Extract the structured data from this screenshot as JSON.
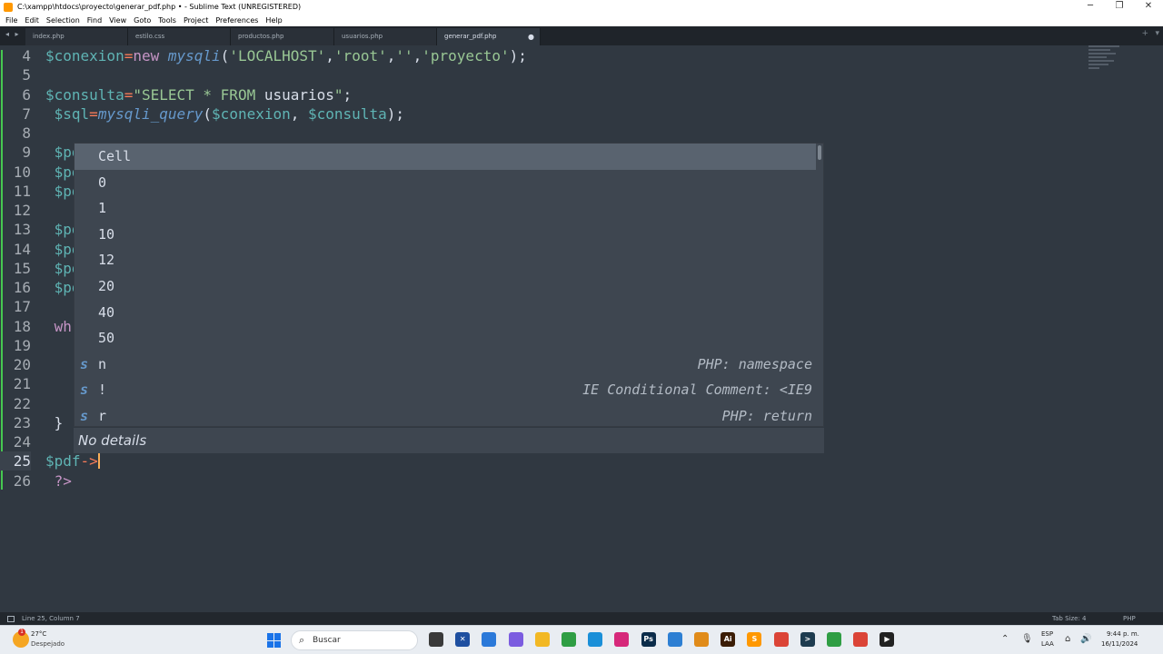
{
  "window": {
    "title": "C:\\xampp\\htdocs\\proyecto\\generar_pdf.php • - Sublime Text (UNREGISTERED)",
    "minimize": "─",
    "maximize": "❐",
    "close": "✕"
  },
  "menu": [
    "File",
    "Edit",
    "Selection",
    "Find",
    "View",
    "Goto",
    "Tools",
    "Project",
    "Preferences",
    "Help"
  ],
  "tabs": {
    "nav": "◂ ▸",
    "items": [
      {
        "label": "index.php"
      },
      {
        "label": "estilo.css"
      },
      {
        "label": "productos.php"
      },
      {
        "label": "usuarios.php"
      },
      {
        "label": "generar_pdf.php",
        "active": true,
        "close": "●"
      }
    ],
    "plus": "+",
    "menu": "▾"
  },
  "editor": {
    "lines": [
      {
        "n": "4",
        "segs": [
          [
            "var",
            "$conexion"
          ],
          [
            "op",
            "="
          ],
          [
            "kw",
            "new "
          ],
          [
            "fn",
            "mysqli"
          ],
          [
            "",
            "("
          ],
          [
            "str",
            "'LOCALHOST'"
          ],
          [
            "",
            ","
          ],
          [
            "str",
            "'root'"
          ],
          [
            "",
            ","
          ],
          [
            "str",
            "''"
          ],
          [
            "",
            ","
          ],
          [
            "str",
            "'proyecto'"
          ],
          [
            "",
            ");"
          ]
        ]
      },
      {
        "n": "5",
        "segs": []
      },
      {
        "n": "6",
        "segs": [
          [
            "var",
            "$consulta"
          ],
          [
            "op",
            "="
          ],
          [
            "str",
            "\"SELECT * FROM "
          ],
          [
            "",
            "usuarios"
          ],
          [
            "str",
            "\""
          ],
          [
            "",
            ";"
          ]
        ]
      },
      {
        "n": "7",
        "segs": [
          [
            "var",
            " $sql"
          ],
          [
            "op",
            "="
          ],
          [
            "fn",
            "mysqli_query"
          ],
          [
            "",
            "("
          ],
          [
            "var",
            "$conexion"
          ],
          [
            "",
            ", "
          ],
          [
            "var",
            "$consulta"
          ],
          [
            "",
            ");"
          ]
        ]
      },
      {
        "n": "8",
        "segs": []
      },
      {
        "n": "9",
        "segs": [
          [
            "var",
            " $pd"
          ]
        ]
      },
      {
        "n": "10",
        "segs": [
          [
            "var",
            " $pd"
          ]
        ]
      },
      {
        "n": "11",
        "segs": [
          [
            "var",
            " $pd"
          ]
        ]
      },
      {
        "n": "12",
        "segs": []
      },
      {
        "n": "13",
        "segs": [
          [
            "var",
            " $pd"
          ]
        ]
      },
      {
        "n": "14",
        "segs": [
          [
            "var",
            " $pd"
          ]
        ]
      },
      {
        "n": "15",
        "segs": [
          [
            "var",
            " $pd"
          ]
        ]
      },
      {
        "n": "16",
        "segs": [
          [
            "var",
            " $pd"
          ]
        ]
      },
      {
        "n": "17",
        "segs": []
      },
      {
        "n": "18",
        "segs": [
          [
            "kw",
            " wh"
          ]
        ]
      },
      {
        "n": "19",
        "segs": []
      },
      {
        "n": "20",
        "segs": []
      },
      {
        "n": "21",
        "segs": []
      },
      {
        "n": "22",
        "segs": []
      },
      {
        "n": "23",
        "segs": [
          [
            "",
            " }"
          ]
        ]
      },
      {
        "n": "24",
        "segs": []
      },
      {
        "n": "25",
        "segs": [
          [
            "var",
            "$pdf"
          ],
          [
            "op",
            "->"
          ]
        ],
        "cursor": true
      },
      {
        "n": "26",
        "segs": [
          [
            "kw",
            " ?>"
          ]
        ]
      }
    ]
  },
  "autocomplete": {
    "items": [
      {
        "kind": "",
        "label": "Cell",
        "detail": "",
        "selected": true
      },
      {
        "kind": "",
        "label": "0",
        "detail": ""
      },
      {
        "kind": "",
        "label": "1",
        "detail": ""
      },
      {
        "kind": "",
        "label": "10",
        "detail": ""
      },
      {
        "kind": "",
        "label": "12",
        "detail": ""
      },
      {
        "kind": "",
        "label": "20",
        "detail": ""
      },
      {
        "kind": "",
        "label": "40",
        "detail": ""
      },
      {
        "kind": "",
        "label": "50",
        "detail": ""
      },
      {
        "kind": "s",
        "label": "n",
        "detail": "PHP: namespace"
      },
      {
        "kind": "s",
        "label": "!",
        "detail": "IE Conditional Comment: <IE9"
      },
      {
        "kind": "s",
        "label": "r",
        "detail": "PHP: return"
      }
    ],
    "footer": "No details"
  },
  "status": {
    "position": "Line 25, Column 7",
    "tab_size": "Tab Size: 4",
    "syntax": "PHP"
  },
  "taskbar": {
    "weather_temp": "27°C",
    "weather_desc": "Despejado",
    "weather_badge": "1",
    "search_placeholder": "Buscar",
    "apps": [
      {
        "name": "task-view-icon",
        "color": "#3a3a3a",
        "glyph": ""
      },
      {
        "name": "visual-studio-icon",
        "color": "#1e4fa0",
        "glyph": "✕"
      },
      {
        "name": "store-icon",
        "color": "#2b79d9",
        "glyph": ""
      },
      {
        "name": "copilot-icon",
        "color": "#7b5ce0",
        "glyph": ""
      },
      {
        "name": "file-explorer-icon",
        "color": "#f2b824",
        "glyph": ""
      },
      {
        "name": "chrome-icon",
        "color": "#2f9e44",
        "glyph": ""
      },
      {
        "name": "edge-icon",
        "color": "#1a8fd8",
        "glyph": ""
      },
      {
        "name": "instagram-icon",
        "color": "#d6287a",
        "glyph": ""
      },
      {
        "name": "photoshop-icon",
        "color": "#0b2c4a",
        "glyph": "Ps"
      },
      {
        "name": "chrome-canary-icon",
        "color": "#2d7fd3",
        "glyph": ""
      },
      {
        "name": "chrome-beta-icon",
        "color": "#e08b1a",
        "glyph": ""
      },
      {
        "name": "illustrator-icon",
        "color": "#3b1d06",
        "glyph": "Ai"
      },
      {
        "name": "sublime-text-icon",
        "color": "#ff9800",
        "glyph": "S"
      },
      {
        "name": "chrome-profile-icon",
        "color": "#db4437",
        "glyph": ""
      },
      {
        "name": "terminal-icon",
        "color": "#1d3b4f",
        "glyph": ">"
      },
      {
        "name": "chrome-dev-icon",
        "color": "#2f9e44",
        "glyph": ""
      },
      {
        "name": "chrome-main-icon",
        "color": "#db4437",
        "glyph": ""
      },
      {
        "name": "media-player-icon",
        "color": "#222222",
        "glyph": "▶"
      }
    ],
    "lang_line1": "ESP",
    "lang_line2": "LAA",
    "time": "9:44 p. m.",
    "date": "16/11/2024"
  }
}
